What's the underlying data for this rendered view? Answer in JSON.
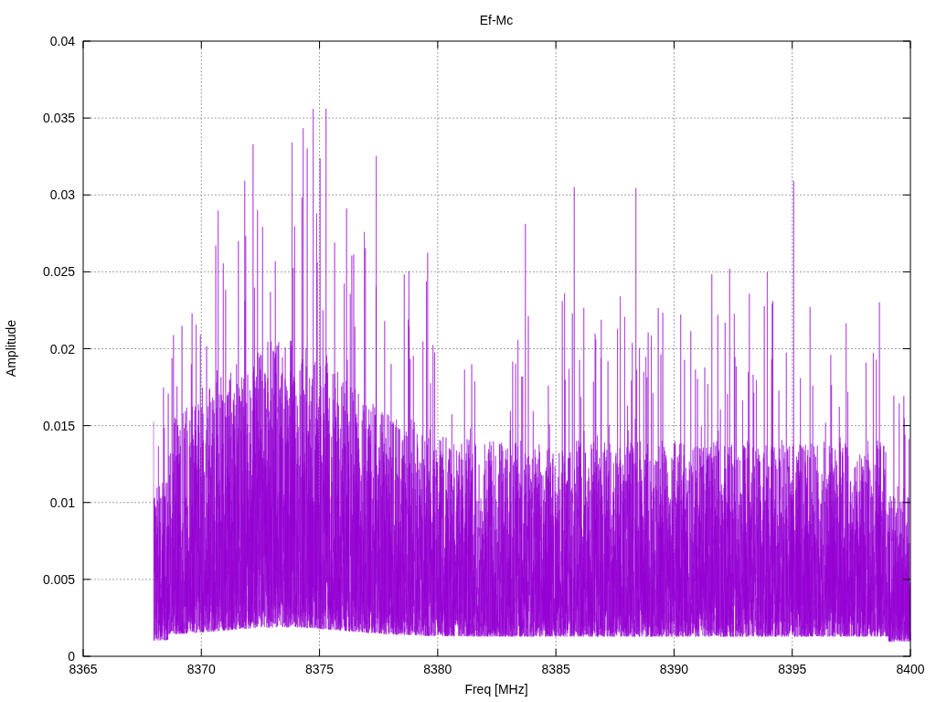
{
  "plot": {
    "title": "Ef-Mc",
    "xlabel": "Freq [MHz]",
    "ylabel": "Amplitude",
    "xtick_labels": [
      "8365",
      "8370",
      "8375",
      "8380",
      "8385",
      "8390",
      "8395",
      "8400"
    ],
    "ytick_labels": [
      "0.04",
      "0.035",
      "0.03",
      "0.025",
      "0.02",
      "0.015",
      "0.01",
      "0.005",
      "0"
    ]
  }
}
